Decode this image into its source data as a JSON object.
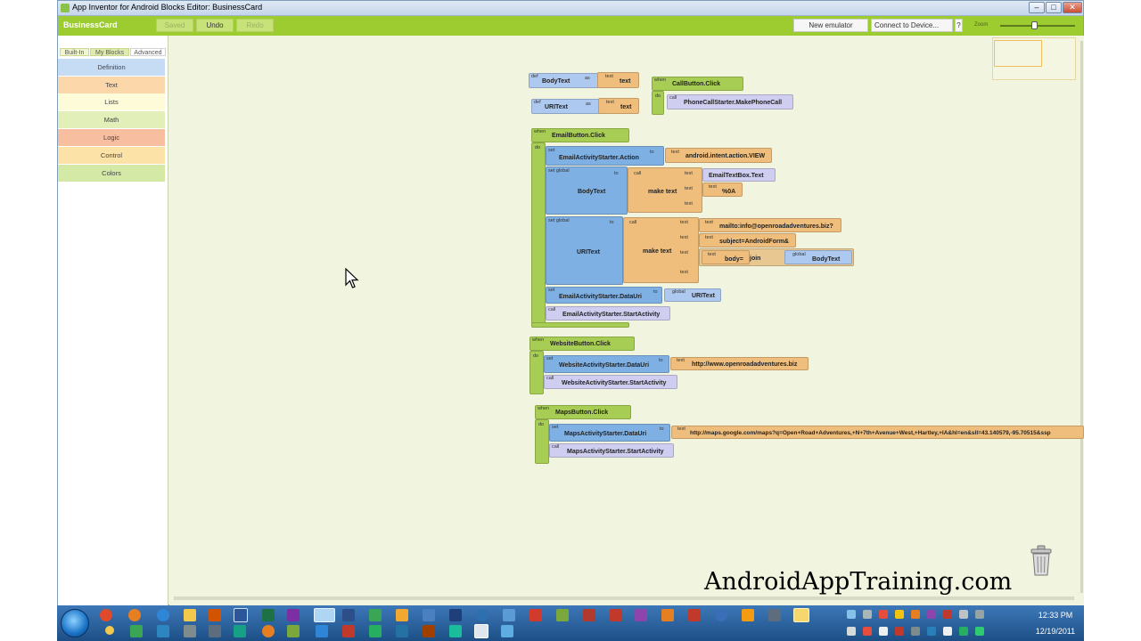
{
  "window": {
    "title": "App Inventor for Android Blocks Editor: BusinessCard",
    "minimize": "–",
    "maximize": "□",
    "close": "✕"
  },
  "toolbar": {
    "project": "BusinessCard",
    "saved": "Saved",
    "undo": "Undo",
    "redo": "Redo",
    "new_emulator": "New emulator",
    "connect": "Connect to Device...",
    "help": "?",
    "zoom_label": "Zoom",
    "zoom_level": 0.45
  },
  "palette": {
    "tabs": [
      "Built-In",
      "My Blocks",
      "Advanced"
    ],
    "categories": [
      {
        "label": "Definition",
        "color": "#c6dcf5"
      },
      {
        "label": "Text",
        "color": "#fbd7a9"
      },
      {
        "label": "Lists",
        "color": "#fdfbd8"
      },
      {
        "label": "Math",
        "color": "#e2efb8"
      },
      {
        "label": "Logic",
        "color": "#f7bfa0"
      },
      {
        "label": "Control",
        "color": "#fde2a8"
      },
      {
        "label": "Colors",
        "color": "#d3e9a5"
      }
    ]
  },
  "blocks": {
    "def": "def",
    "as": "as",
    "text": "text",
    "when": "when",
    "do": "do",
    "call": "call",
    "set": "set",
    "to": "to",
    "set_global": "set global",
    "global": "global",
    "make_text": "make text",
    "join": "join",
    "bodytext_def": "BodyText",
    "uritext_def": "URIText",
    "text_empty": "text",
    "callbutton": "CallButton.Click",
    "makephonecall": "PhoneCallStarter.MakePhoneCall",
    "emailbutton": "EmailButton.Click",
    "email_action": "EmailActivityStarter.Action",
    "intent_view": "android.intent.action.VIEW",
    "bodytext": "BodyText",
    "emailtextbox": "EmailTextBox.Text",
    "newline": "%0A",
    "uritext": "URIText",
    "mailto": "mailto:info@openroadadventures.biz?",
    "subject": "subject=AndroidForm&",
    "body": "body=",
    "email_datauri": "EmailActivityStarter.DataUri",
    "email_start": "EmailActivityStarter.StartActivity",
    "websitebutton": "WebsiteButton.Click",
    "website_datauri": "WebsiteActivityStarter.DataUri",
    "website_url": "http://www.openroadadventures.biz",
    "website_start": "WebsiteActivityStarter.StartActivity",
    "mapsbutton": "MapsButton.Click",
    "maps_datauri": "MapsActivityStarter.DataUri",
    "maps_url": "http://maps.google.com/maps?q=Open+Road+Adventures,+N+7th+Avenue+West,+Hartley,+IA&hl=en&sll=43.140579,-95.70515&ssp",
    "maps_start": "MapsActivityStarter.StartActivity"
  },
  "taskbar": {
    "time": "12:33 PM",
    "date": "12/19/2011"
  },
  "overlay": {
    "watermark": "AndroidAppTraining.com"
  },
  "icons": [
    "app-icon",
    "start-orb-icon",
    "trash-icon",
    "mouse-cursor-icon",
    "zoom-slider-icon"
  ]
}
